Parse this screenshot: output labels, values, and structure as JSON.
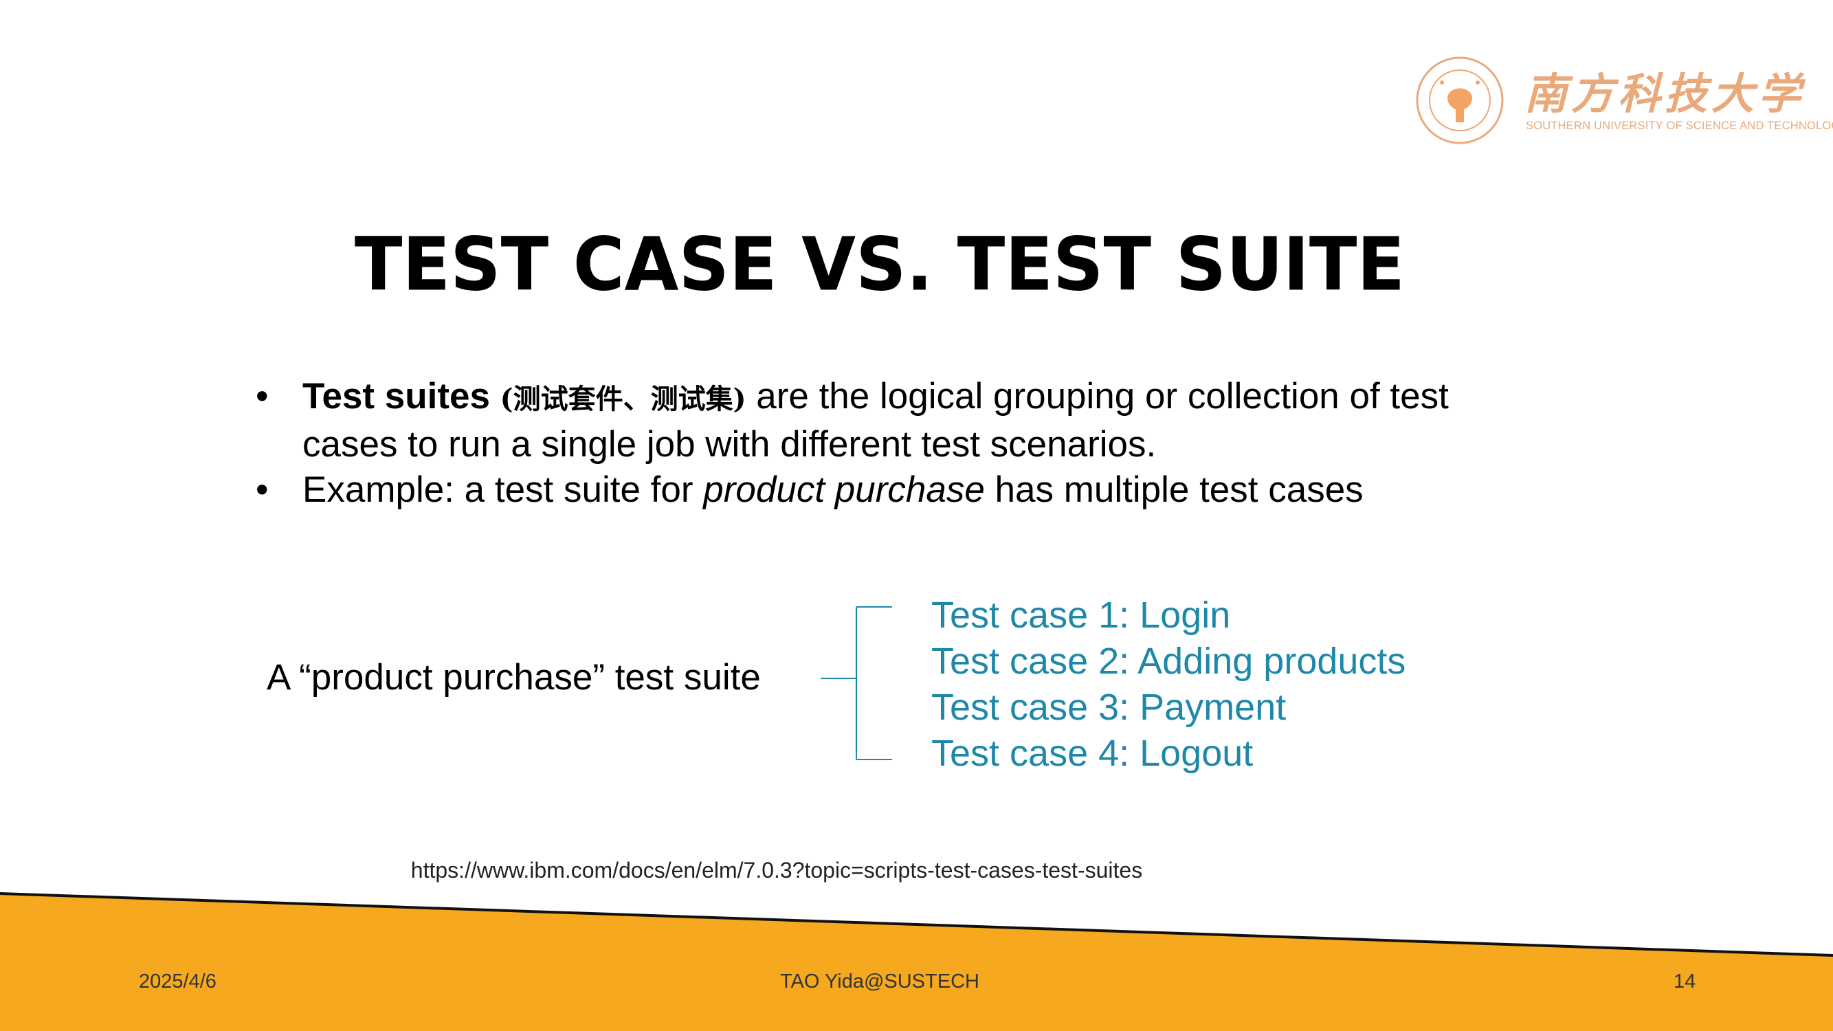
{
  "logo": {
    "cn": "南方科技大学",
    "en": "SOUTHERN UNIVERSITY OF SCIENCE AND TECHNOLOGY"
  },
  "title": "TEST CASE VS. TEST SUITE",
  "bullets": {
    "b1_bold": "Test suites ",
    "b1_cn": "(测试套件、测试集)",
    "b1_rest": " are the logical grouping or collection of test cases to run a single job with different test scenarios.",
    "b2_pre": "Example: a test suite for ",
    "b2_italic": "product purchase",
    "b2_post": " has multiple test cases",
    "bullet_char": "•"
  },
  "suite_label": "A “product purchase” test suite",
  "test_cases": [
    "Test case 1: Login",
    "Test case 2: Adding products",
    "Test case 3: Payment",
    "Test case 4: Logout"
  ],
  "reference_url": "https://www.ibm.com/docs/en/elm/7.0.3?topic=scripts-test-cases-test-suites",
  "footer": {
    "date": "2025/4/6",
    "center": "TAO Yida@SUSTECH",
    "page": "14"
  },
  "colors": {
    "accent_blue": "#1e88a8",
    "banner_orange": "#f6a91f",
    "logo_orange": "#e9a97a"
  }
}
